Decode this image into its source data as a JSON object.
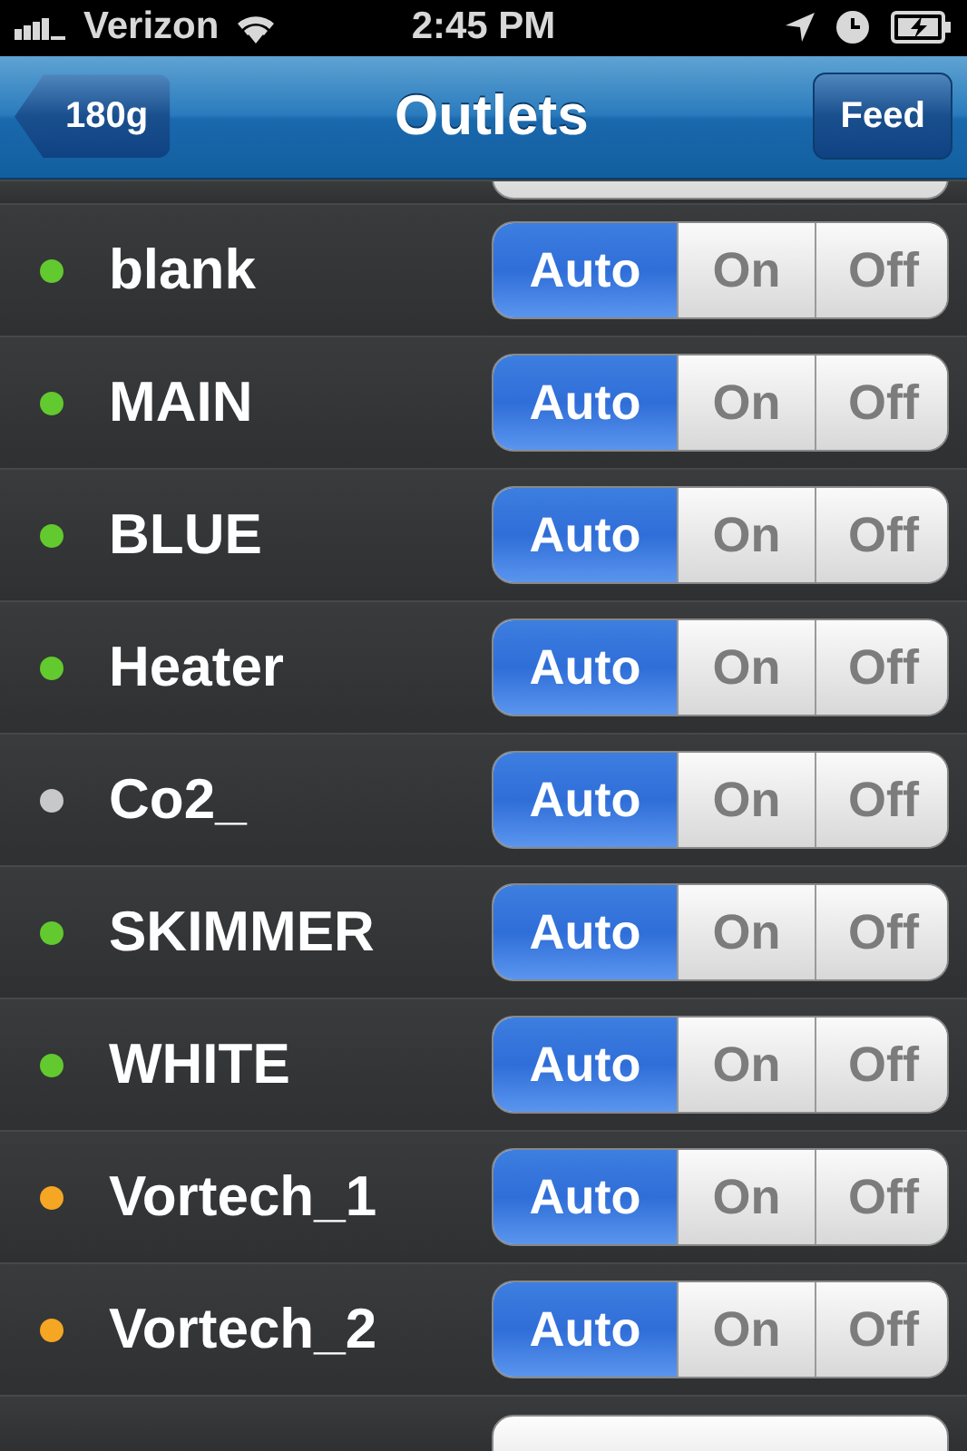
{
  "status_bar": {
    "carrier": "Verizon",
    "time": "2:45 PM"
  },
  "nav_bar": {
    "back_button": "180g",
    "title": "Outlets",
    "right_button": "Feed"
  },
  "outlets": [
    {
      "name": "blank",
      "color": "#62c92e",
      "options": [
        {
          "label": "Auto",
          "selected": true
        },
        {
          "label": "On",
          "selected": false
        },
        {
          "label": "Off",
          "selected": false
        }
      ]
    },
    {
      "name": "MAIN",
      "color": "#62c92e",
      "options": [
        {
          "label": "Auto",
          "selected": true
        },
        {
          "label": "On",
          "selected": false
        },
        {
          "label": "Off",
          "selected": false
        }
      ]
    },
    {
      "name": "BLUE",
      "color": "#62c92e",
      "options": [
        {
          "label": "Auto",
          "selected": true
        },
        {
          "label": "On",
          "selected": false
        },
        {
          "label": "Off",
          "selected": false
        }
      ]
    },
    {
      "name": "Heater",
      "color": "#62c92e",
      "options": [
        {
          "label": "Auto",
          "selected": true
        },
        {
          "label": "On",
          "selected": false
        },
        {
          "label": "Off",
          "selected": false
        }
      ]
    },
    {
      "name": "Co2_",
      "color": "#c8c8c8",
      "options": [
        {
          "label": "Auto",
          "selected": true
        },
        {
          "label": "On",
          "selected": false
        },
        {
          "label": "Off",
          "selected": false
        }
      ]
    },
    {
      "name": "SKIMMER",
      "color": "#62c92e",
      "options": [
        {
          "label": "Auto",
          "selected": true
        },
        {
          "label": "On",
          "selected": false
        },
        {
          "label": "Off",
          "selected": false
        }
      ]
    },
    {
      "name": "WHITE",
      "color": "#62c92e",
      "options": [
        {
          "label": "Auto",
          "selected": true
        },
        {
          "label": "On",
          "selected": false
        },
        {
          "label": "Off",
          "selected": false
        }
      ]
    },
    {
      "name": "Vortech_1",
      "color": "#f5a623",
      "options": [
        {
          "label": "Auto",
          "selected": true
        },
        {
          "label": "On",
          "selected": false
        },
        {
          "label": "Off",
          "selected": false
        }
      ]
    },
    {
      "name": "Vortech_2",
      "color": "#f5a623",
      "options": [
        {
          "label": "Auto",
          "selected": true
        },
        {
          "label": "On",
          "selected": false
        },
        {
          "label": "Off",
          "selected": false
        }
      ]
    }
  ]
}
